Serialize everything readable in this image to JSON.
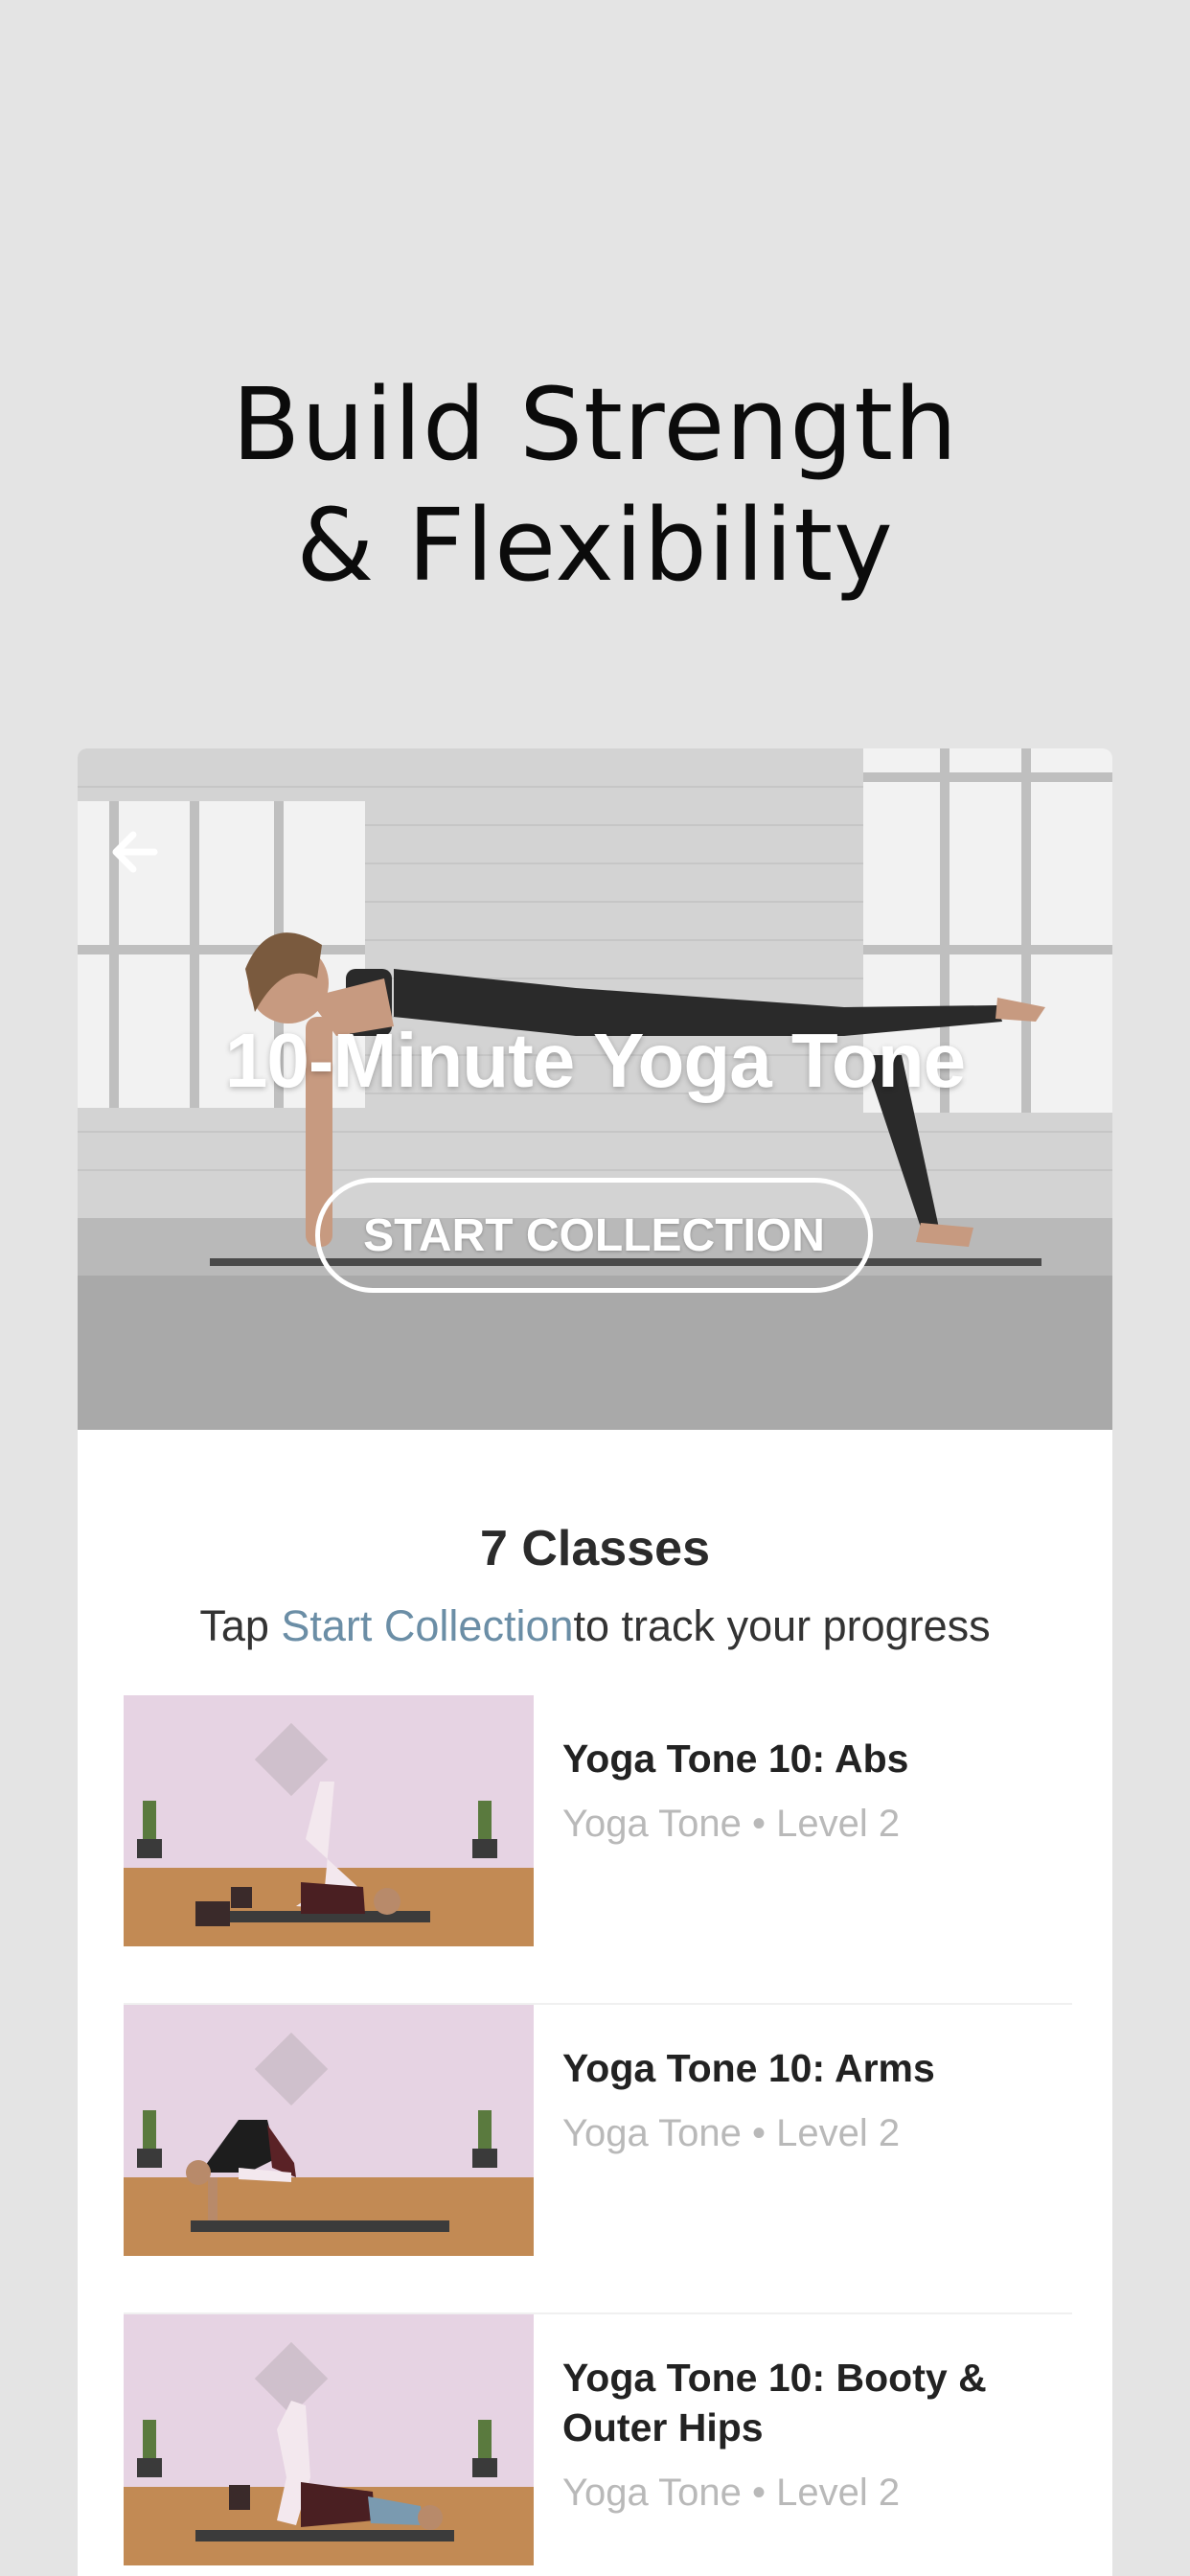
{
  "promo": {
    "headline_line1": "Build Strength",
    "headline_line2": "& Flexibility"
  },
  "hero": {
    "back_icon": "arrow-left-icon",
    "title": "10-Minute Yoga Tone",
    "start_button_label": "START COLLECTION"
  },
  "summary": {
    "classes_count": "7 Classes",
    "hint_prefix": "Tap ",
    "hint_link": "Start Collection",
    "hint_suffix": "to track your progress"
  },
  "classes": [
    {
      "title": "Yoga Tone 10: Abs",
      "subtitle": "Yoga Tone • Level 2"
    },
    {
      "title": "Yoga Tone 10: Arms",
      "subtitle": "Yoga Tone • Level 2"
    },
    {
      "title": "Yoga Tone 10: Booty & Outer Hips",
      "subtitle": "Yoga Tone • Level 2"
    }
  ],
  "colors": {
    "background": "#e4e4e4",
    "link": "#6b8ea6",
    "card": "#ffffff"
  }
}
